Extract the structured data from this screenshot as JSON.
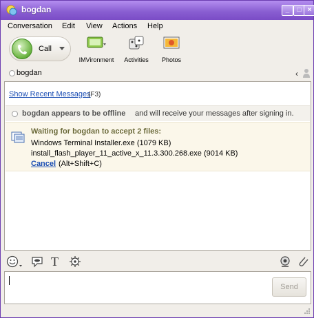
{
  "window": {
    "title": "bogdan"
  },
  "menu": [
    "Conversation",
    "Edit",
    "View",
    "Actions",
    "Help"
  ],
  "toolbar": {
    "call_label": "Call",
    "tools": [
      {
        "label": "IMVironment",
        "icon": "imvironment-icon"
      },
      {
        "label": "Activities",
        "icon": "activities-icon"
      },
      {
        "label": "Photos",
        "icon": "photos-icon"
      }
    ]
  },
  "contact": {
    "name": "bogdan",
    "status": "offline"
  },
  "chat": {
    "recent_link": "Show Recent Messages",
    "recent_key": "(F3)",
    "offline_bold": "bogdan appears to be offline",
    "offline_rest": "and will receive your messages after signing in.",
    "transfer": {
      "title": "Waiting for bogdan to accept 2 files:",
      "file1": "Windows Terminal Installer.exe (1079 KB)",
      "file2": "install_flash_player_11_active_x_11.3.300.268.exe (9014 KB)",
      "cancel_label": "Cancel",
      "cancel_shortcut": "(Alt+Shift+C)"
    }
  },
  "format_bar": {
    "icons": [
      "emoticon-icon",
      "audible-icon",
      "text-format-icon",
      "settings-icon",
      "webcam-icon",
      "attach-icon"
    ],
    "text_format_glyph": "T"
  },
  "input": {
    "value": "",
    "send_label": "Send"
  },
  "colors": {
    "title_bar": "#8a5fd2",
    "link": "#1a4db3",
    "offline_text": "#555555",
    "transfer_title": "#6b6a3a"
  }
}
